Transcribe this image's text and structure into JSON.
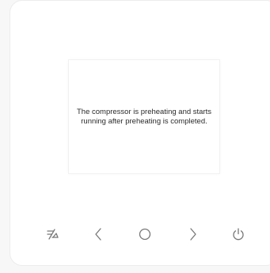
{
  "display": {
    "message": "The compressor is preheating and starts running after preheating is completed."
  },
  "controls": [
    {
      "name": "mode-button",
      "icon": "mode-icon"
    },
    {
      "name": "left-button",
      "icon": "chevron-left-icon"
    },
    {
      "name": "ok-button",
      "icon": "circle-icon"
    },
    {
      "name": "right-button",
      "icon": "chevron-right-icon"
    },
    {
      "name": "power-button",
      "icon": "power-icon"
    }
  ],
  "colors": {
    "background": "#f7f7f7",
    "panel": "#ffffff",
    "icon": "#777777",
    "text": "#2b2b2b"
  }
}
